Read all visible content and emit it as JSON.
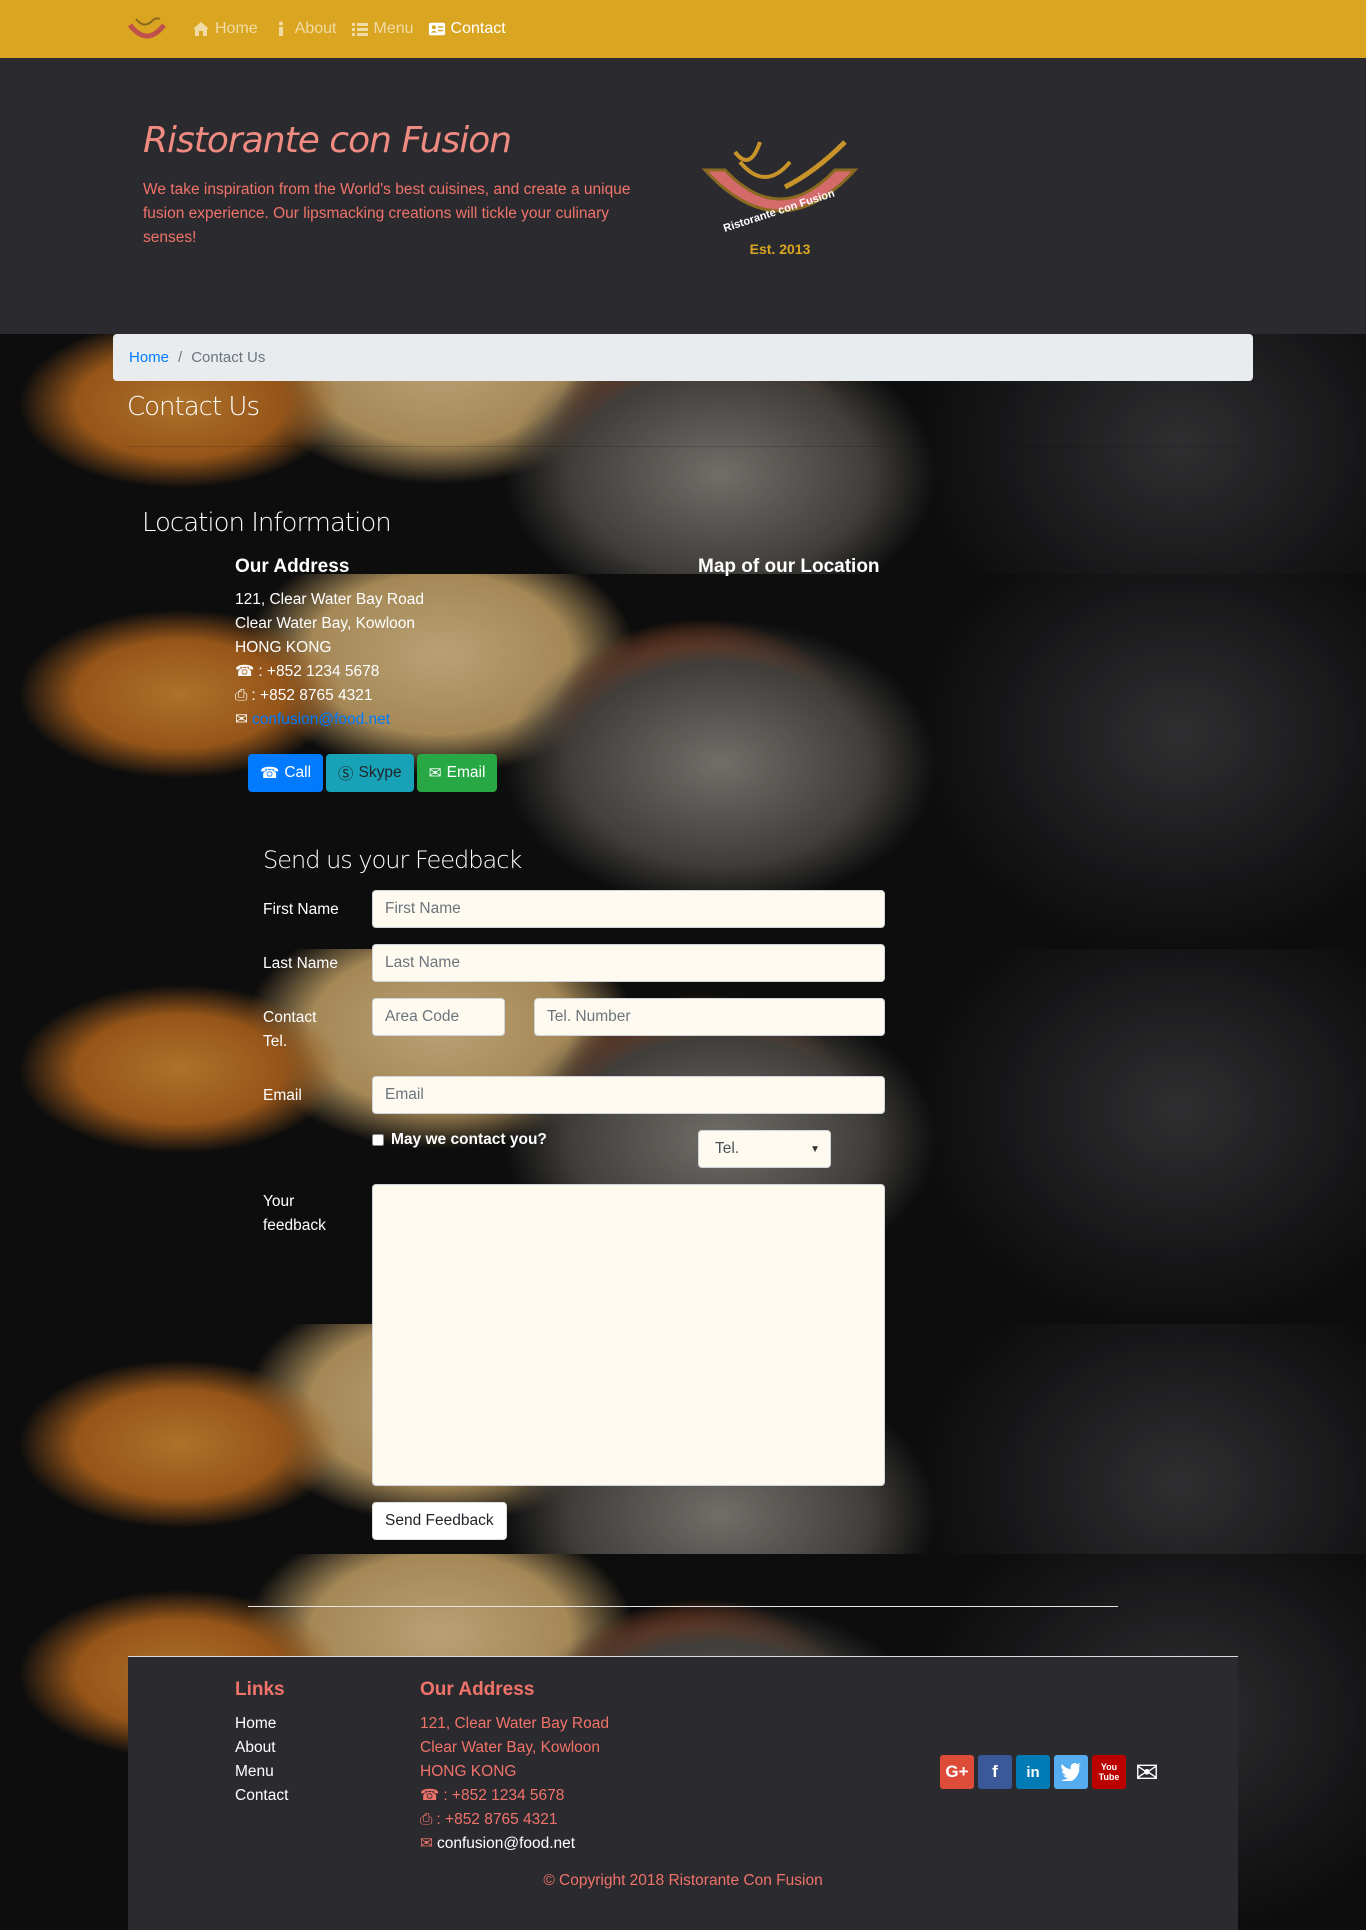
{
  "nav": {
    "items": [
      {
        "label": "Home",
        "icon": "home-icon"
      },
      {
        "label": "About",
        "icon": "info-icon"
      },
      {
        "label": "Menu",
        "icon": "list-icon"
      },
      {
        "label": "Contact",
        "icon": "address-card-icon"
      }
    ],
    "active": "Contact",
    "bg_color": "#daa520"
  },
  "hero": {
    "title": "Ristorante con Fusion",
    "description": "We take inspiration from the World's best cuisines, and create a unique fusion experience. Our lipsmacking creations will tickle your culinary senses!",
    "logo_text": "Ristorante con Fusion",
    "logo_est": "Est. 2013"
  },
  "breadcrumb": {
    "home": "Home",
    "separator": "/",
    "current": "Contact Us"
  },
  "page_title": "Contact Us",
  "location": {
    "heading": "Location Information",
    "address_heading": "Our Address",
    "map_heading": "Map of our Location",
    "line1": "121, Clear Water Bay Road",
    "line2": "Clear Water Bay, Kowloon",
    "line3": "HONG KONG",
    "phone": ": +852 1234 5678",
    "fax": ": +852 8765 4321",
    "email": "confusion@food.net"
  },
  "buttons": {
    "call": "Call",
    "skype": "Skype",
    "email": "Email"
  },
  "feedback": {
    "heading": "Send us your Feedback",
    "first_name_label": "First Name",
    "first_name_placeholder": "First Name",
    "last_name_label": "Last Name",
    "last_name_placeholder": "Last Name",
    "contact_label": "Contact Tel.",
    "area_code_placeholder": "Area Code",
    "tel_placeholder": "Tel. Number",
    "email_label": "Email",
    "email_placeholder": "Email",
    "checkbox_label": "May we contact you?",
    "select_value": "Tel.",
    "feedback_label": "Your feedback",
    "submit": "Send Feedback"
  },
  "footer": {
    "links_heading": "Links",
    "links": [
      "Home",
      "About",
      "Menu",
      "Contact"
    ],
    "address_heading": "Our Address",
    "line1": "121, Clear Water Bay Road",
    "line2": "Clear Water Bay, Kowloon",
    "line3": "HONG KONG",
    "phone": ": +852 1234 5678",
    "fax": ": +852 8765 4321",
    "email": "confusion@food.net",
    "socials": [
      {
        "name": "google-plus-icon",
        "glyph": "G+",
        "color": "#dd4b39"
      },
      {
        "name": "facebook-icon",
        "glyph": "f",
        "color": "#3b5998"
      },
      {
        "name": "linkedin-icon",
        "glyph": "in",
        "color": "#007bb6"
      },
      {
        "name": "twitter-icon",
        "glyph": "t",
        "color": "#55acee"
      },
      {
        "name": "youtube-icon",
        "glyph": "You",
        "color": "#bb0000"
      },
      {
        "name": "envelope-icon",
        "glyph": "✉",
        "color": "transparent"
      }
    ],
    "copyright": "© Copyright 2018 Ristorante Con Fusion"
  },
  "colors": {
    "accent": "#daa520",
    "salmon": "#f0736a",
    "dark": "#2b2a2f",
    "link": "#007bff"
  }
}
